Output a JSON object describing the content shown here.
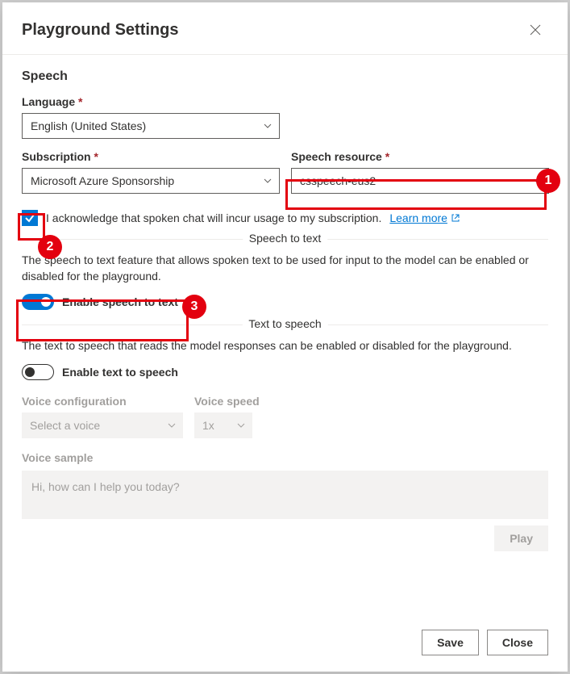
{
  "modal": {
    "title": "Playground Settings"
  },
  "section": {
    "title": "Speech"
  },
  "language": {
    "label": "Language",
    "value": "English (United States)"
  },
  "subscription": {
    "label": "Subscription",
    "value": "Microsoft Azure Sponsorship"
  },
  "resource": {
    "label": "Speech resource",
    "value": "csspeech-eus2"
  },
  "consent": {
    "text": "I acknowledge that spoken chat will incur usage to my subscription.",
    "link": "Learn more"
  },
  "stt": {
    "sep": "Speech to text",
    "desc": "The speech to text feature that allows spoken text to be used for input to the model can be enabled or disabled for the playground.",
    "toggle": "Enable speech to text"
  },
  "tts": {
    "sep": "Text to speech",
    "desc": "The text to speech that reads the model responses can be enabled or disabled for the playground.",
    "toggle": "Enable text to speech",
    "voiceConfigLabel": "Voice configuration",
    "voiceConfigValue": "Select a voice",
    "voiceSpeedLabel": "Voice speed",
    "voiceSpeedValue": "1x",
    "sampleLabel": "Voice sample",
    "sampleText": "Hi, how can I help you today?",
    "play": "Play"
  },
  "footer": {
    "save": "Save",
    "close": "Close"
  },
  "callouts": {
    "c1": "1",
    "c2": "2",
    "c3": "3"
  }
}
